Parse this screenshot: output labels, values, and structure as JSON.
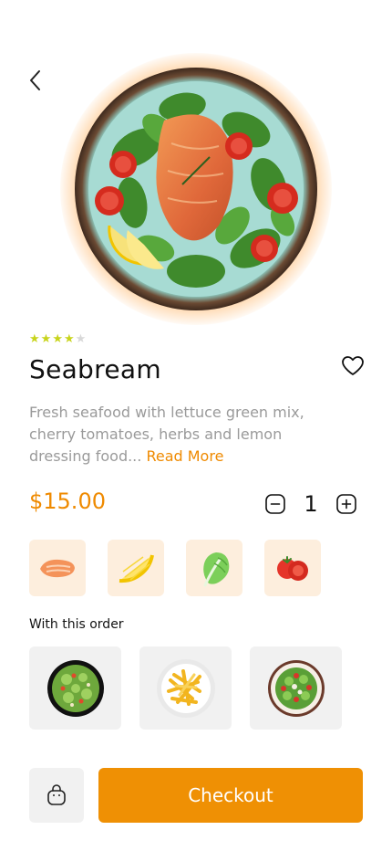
{
  "product": {
    "rating": 4,
    "rating_max": 5,
    "name": "Seabream",
    "description": "Fresh seafood  with lettuce green mix, cherry tomatoes, herbs and lemon dressing food...",
    "read_more": "Read More",
    "price": "$15.00",
    "quantity": "1"
  },
  "ingredients": [
    {
      "icon": "salmon-icon"
    },
    {
      "icon": "lemon-icon"
    },
    {
      "icon": "lettuce-icon"
    },
    {
      "icon": "tomato-icon"
    }
  ],
  "with_order": {
    "label": "With this order",
    "items": [
      {
        "icon": "green-salad-icon"
      },
      {
        "icon": "fries-icon"
      },
      {
        "icon": "mixed-salad-icon"
      }
    ]
  },
  "actions": {
    "checkout_label": "Checkout"
  },
  "colors": {
    "accent": "#EF9004",
    "price": "#EF8A00",
    "star": "#C8D41B",
    "tile_bg": "#FDEEDD",
    "addon_bg": "#F1F1F1"
  }
}
